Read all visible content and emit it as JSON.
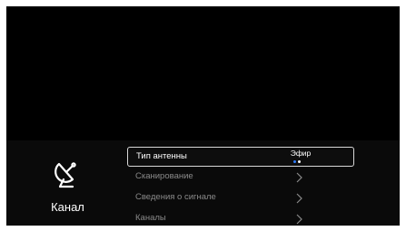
{
  "category": {
    "label": "Канал",
    "icon": "satellite-dish-icon"
  },
  "menu": {
    "items": [
      {
        "label": "Тип антенны",
        "value": "Эфир",
        "selected": true
      },
      {
        "label": "Сканирование",
        "icon": "chevron-right-icon"
      },
      {
        "label": "Сведения о сигнале",
        "icon": "chevron-right-icon"
      },
      {
        "label": "Каналы",
        "icon": "chevron-right-icon"
      }
    ]
  },
  "colors": {
    "background": "#000000",
    "selected_border": "#d8d8d8",
    "text_active": "#ffffff",
    "text_inactive": "#8a8a8a",
    "indicator_active": "#2f7dff"
  }
}
